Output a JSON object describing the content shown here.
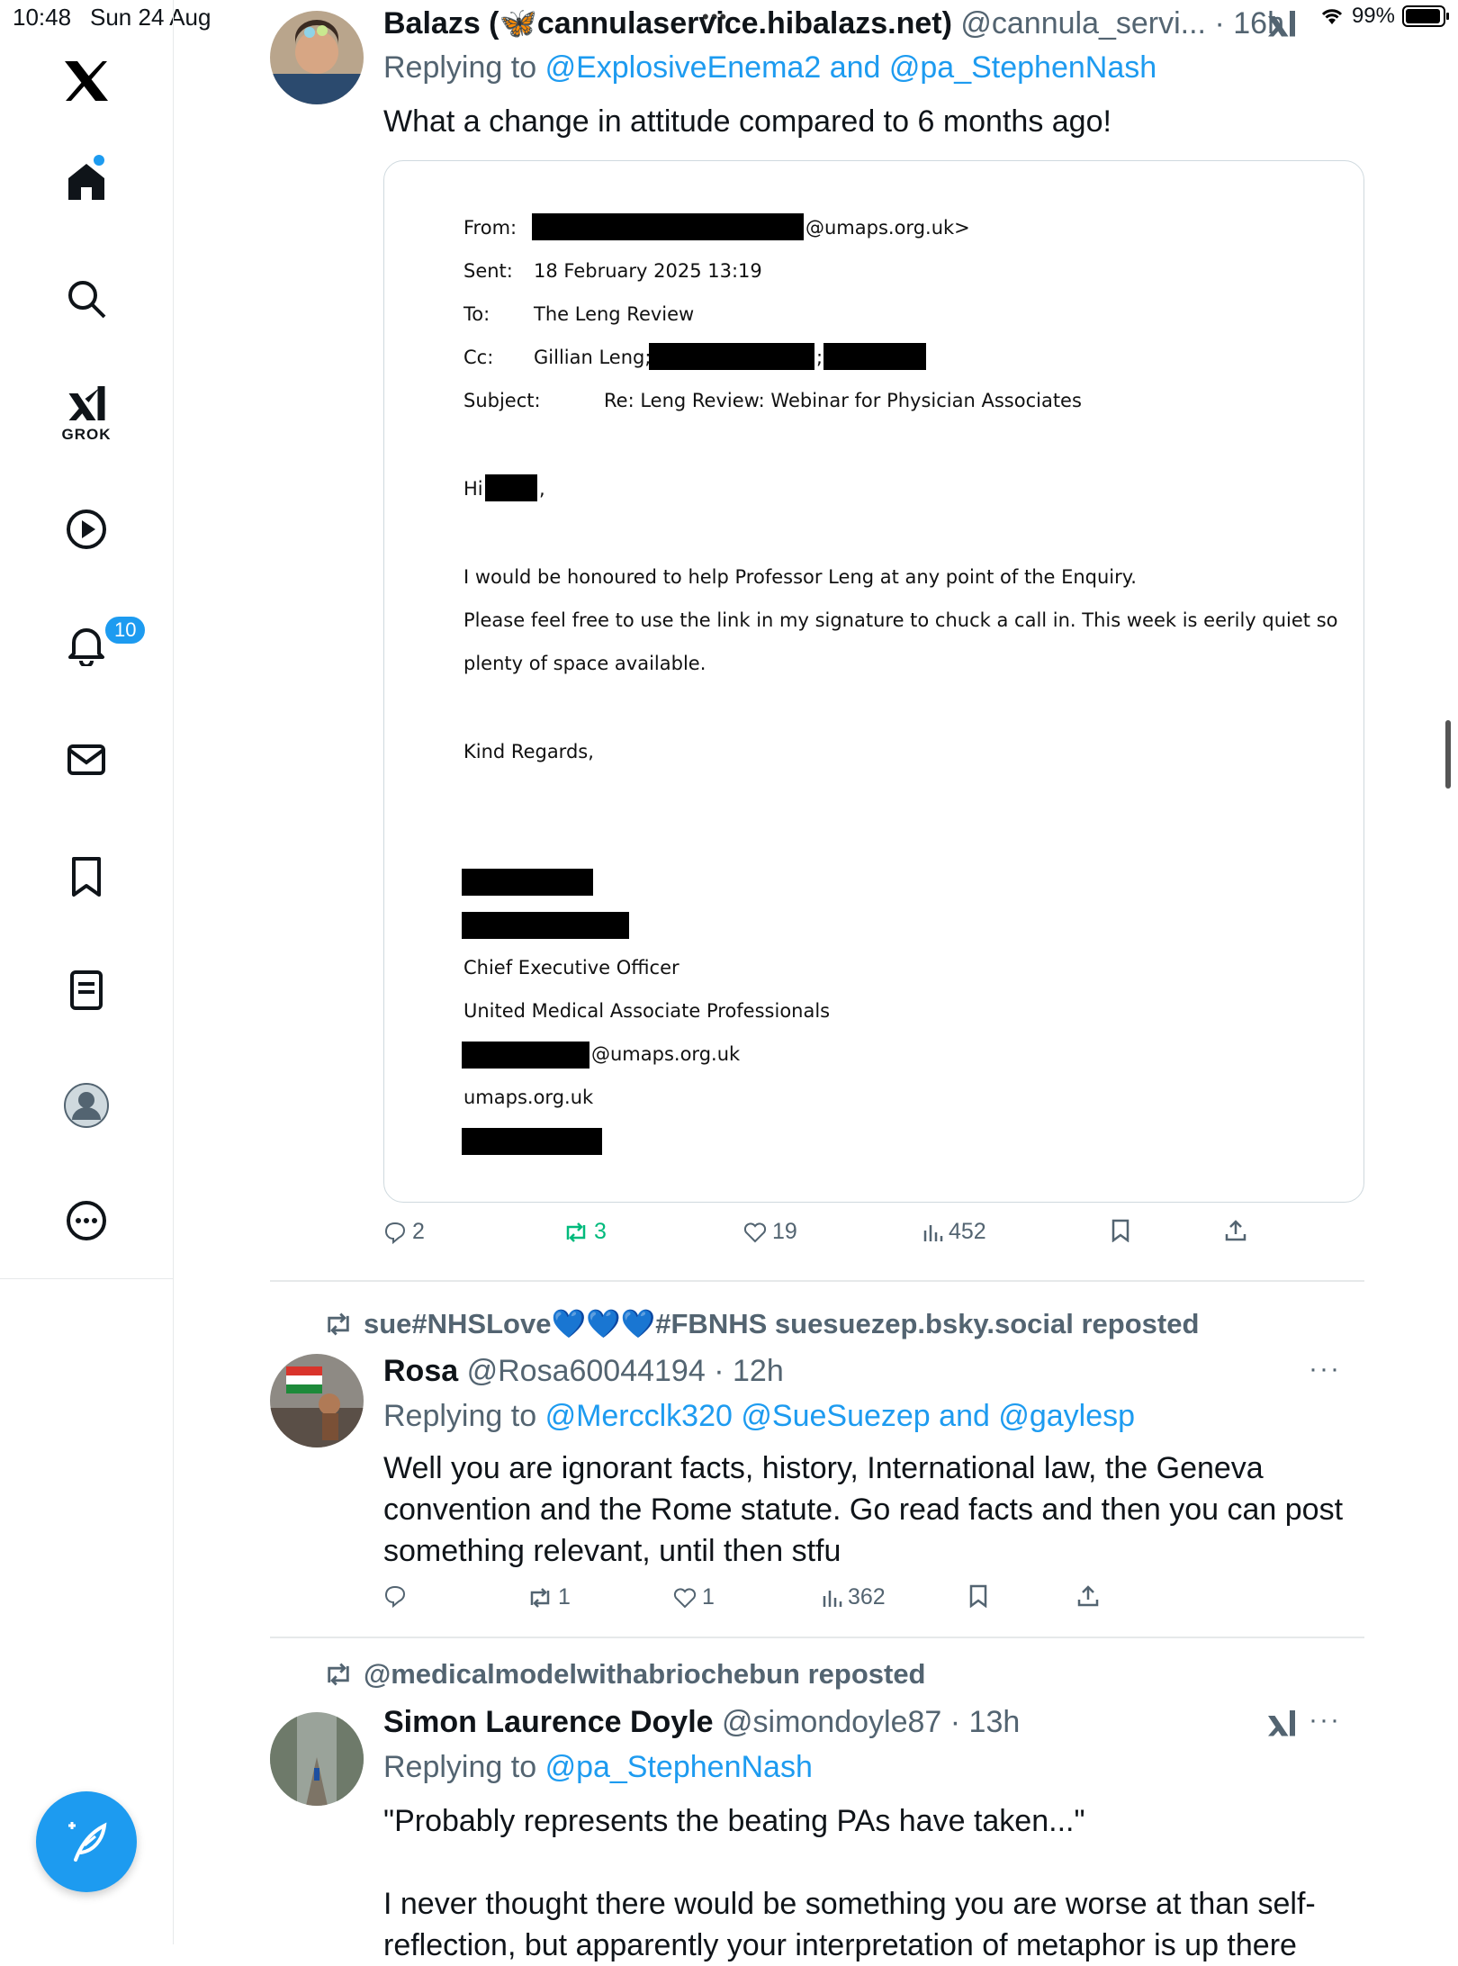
{
  "status_bar": {
    "time": "10:48",
    "date": "Sun 24 Aug",
    "battery": "99%"
  },
  "sidebar": {
    "notifications_badge": "10",
    "grok_label": "GROK"
  },
  "tweets": [
    {
      "author_name": "Balazs (🦋cannulaservice.hibalazs.net)",
      "handle": "@cannula_servi...",
      "time": "16h",
      "replying_label": "Replying to",
      "reply_to_1": "@ExplosiveEnema2",
      "reply_and": "and",
      "reply_to_2": "@pa_StephenNash",
      "text": "What a change in attitude compared to 6 months ago!",
      "email": {
        "from_label": "From:",
        "from_domain": "@umaps.org.uk>",
        "sent_label": "Sent:",
        "sent_value": "18 February 2025 13:19",
        "to_label": "To:",
        "to_value": "The Leng Review",
        "cc_label": "Cc:",
        "cc_value": "Gillian Leng;",
        "cc_sep": ";",
        "subject_label": "Subject:",
        "subject_value": "Re: Leng Review: Webinar for Physician Associates",
        "greeting": "Hi",
        "greeting_comma": ",",
        "line1": "I would be honoured to help Professor Leng at any point of the Enquiry.",
        "line2": "Please feel free to use the link in my signature to chuck a call in. This week is eerily quiet so",
        "line3": "plenty of space available.",
        "signoff": "Kind Regards,",
        "sig_title": "Chief Executive Officer",
        "sig_org": "United Medical Associate Professionals",
        "sig_email_domain": "@umaps.org.uk",
        "sig_site": "umaps.org.uk"
      },
      "replies": "2",
      "reposts": "3",
      "likes": "19",
      "views": "452"
    },
    {
      "repost_by": "sue#NHSLove💙💙💙#FBNHS suesuezep.bsky.social reposted",
      "author_name": "Rosa",
      "handle": "@Rosa60044194",
      "time": "12h",
      "replying_label": "Replying to",
      "reply_to_1": "@Mercclk320",
      "reply_to_2": "@SueSuezep",
      "reply_and": "and",
      "reply_to_3": "@gaylesp",
      "text": "Well you are ignorant facts, history, International law, the Geneva convention and the Rome statute. Go read facts and then you can post something relevant, until then stfu",
      "reposts": "1",
      "likes": "1",
      "views": "362",
      "more": "···"
    },
    {
      "repost_by": "@medicalmodelwithabriochebun reposted",
      "author_name": "Simon Laurence Doyle",
      "handle": "@simondoyle87",
      "time": "13h",
      "replying_label": "Replying to",
      "reply_to_1": "@pa_StephenNash",
      "text_1": "\"Probably represents the beating PAs have taken...\"",
      "text_2": "I never thought there would be something you are worse at than self-",
      "text_3": "reflection, but apparently your interpretation of metaphor is up there",
      "more": "···"
    }
  ],
  "separator_dot": "·"
}
